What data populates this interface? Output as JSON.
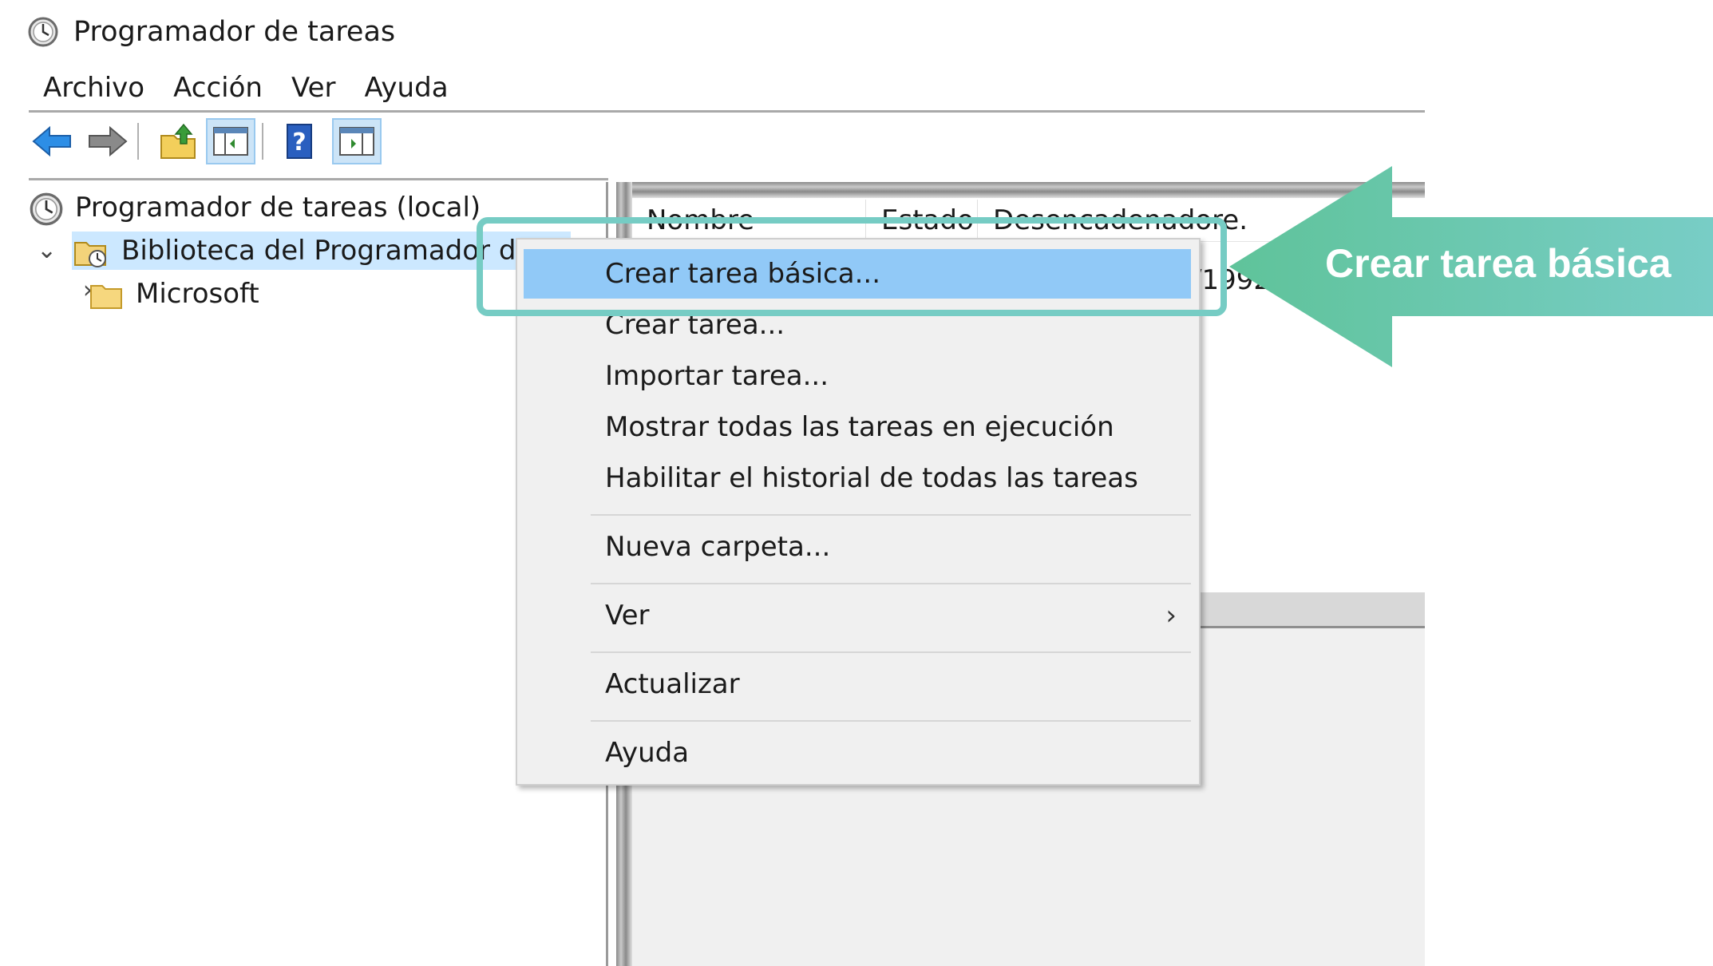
{
  "window": {
    "title": "Programador de tareas"
  },
  "menubar": {
    "items": [
      "Archivo",
      "Acción",
      "Ver",
      "Ayuda"
    ]
  },
  "toolbar": {
    "buttons": [
      "back-arrow-icon",
      "forward-arrow-icon",
      "folder-up-icon",
      "show-hide-console-tree-icon",
      "help-icon",
      "show-hide-action-pane-icon"
    ]
  },
  "tree": {
    "root": "Programador de tareas (local)",
    "library": "Biblioteca del Programador de t",
    "microsoft": "Microsoft"
  },
  "list": {
    "columns": [
      "Nombre",
      "Estado",
      "Desencadenadore."
    ],
    "partial_row_text": "/1992"
  },
  "context_menu": {
    "items": [
      {
        "label": "Crear tarea básica...",
        "highlighted": true
      },
      {
        "label": "Crear tarea..."
      },
      {
        "label": "Importar tarea..."
      },
      {
        "label": "Mostrar todas las tareas en ejecución"
      },
      {
        "label": "Habilitar el historial de todas las tareas"
      },
      {
        "label": "Nueva carpeta..."
      },
      {
        "label": "Ver",
        "submenu": true
      },
      {
        "label": "Actualizar"
      },
      {
        "label": "Ayuda"
      }
    ]
  },
  "annotation": {
    "label": "Crear tarea básica",
    "color": "#76ccc4"
  },
  "colors": {
    "highlight": "#91c9f7",
    "selection": "#cce8ff",
    "menu_bg": "#f0f0f0"
  }
}
